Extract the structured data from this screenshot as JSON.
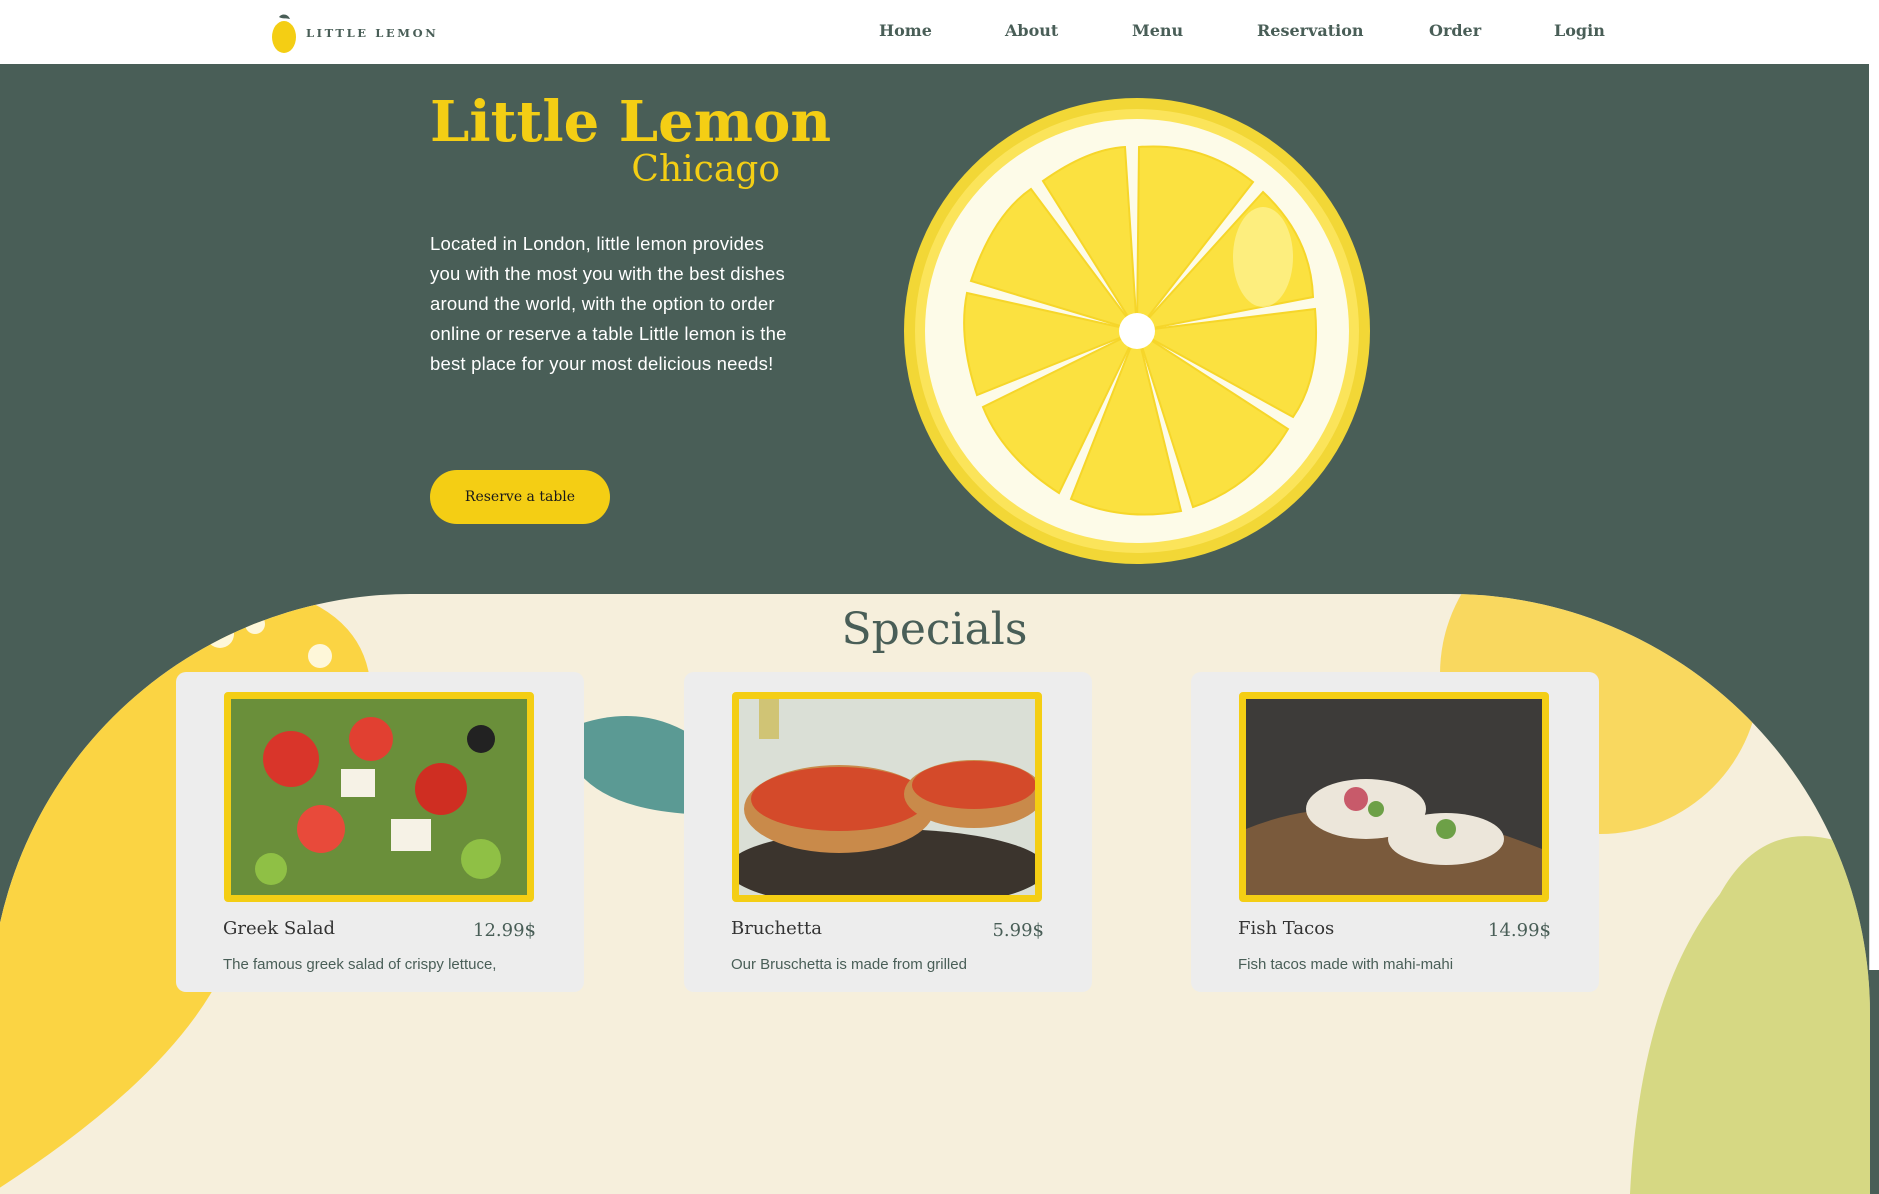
{
  "nav": {
    "logo_text": "LITTLE LEMON",
    "links": [
      "Home",
      "About",
      "Menu",
      "Reservation",
      "Order",
      "Login"
    ]
  },
  "hero": {
    "title": "Little Lemon",
    "subtitle": "Chicago",
    "description": "Located in London, little lemon provides you with the most you with the best dishes around the world, with the option to order online or reserve a table Little lemon is the best place for your most delicious needs!",
    "button_label": "Reserve a table",
    "image_icon": "lemon-slice-icon"
  },
  "specials": {
    "title": "Specials",
    "items": [
      {
        "name": "Greek Salad",
        "price": "12.99$",
        "description": "The famous greek salad of crispy lettuce,",
        "image_icon": "greek-salad-photo"
      },
      {
        "name": "Bruchetta",
        "price": "5.99$",
        "description": "Our Bruschetta is made from grilled",
        "image_icon": "bruschetta-photo"
      },
      {
        "name": "Fish Tacos",
        "price": "14.99$",
        "description": "Fish tacos made with mahi-mahi",
        "image_icon": "fish-tacos-photo"
      }
    ]
  },
  "colors": {
    "primary_green": "#495e57",
    "primary_yellow": "#f4ce14",
    "specials_bg": "#f6efdc"
  }
}
